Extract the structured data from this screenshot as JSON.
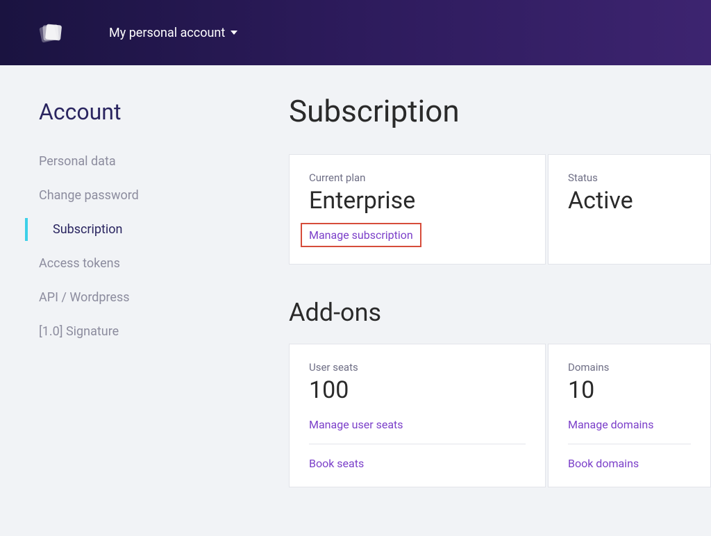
{
  "header": {
    "account_dropdown": "My personal account"
  },
  "sidebar": {
    "title": "Account",
    "items": [
      {
        "label": "Personal data"
      },
      {
        "label": "Change password"
      },
      {
        "label": "Subscription"
      },
      {
        "label": "Access tokens"
      },
      {
        "label": "API / Wordpress"
      },
      {
        "label": "[1.0] Signature"
      }
    ]
  },
  "main": {
    "title": "Subscription",
    "plan_card": {
      "label": "Current plan",
      "value": "Enterprise",
      "link": "Manage subscription"
    },
    "status_card": {
      "label": "Status",
      "value": "Active"
    },
    "addons_title": "Add-ons",
    "seats_card": {
      "label": "User seats",
      "value": "100",
      "link1": "Manage user seats",
      "link2": "Book seats"
    },
    "domains_card": {
      "label": "Domains",
      "value": "10",
      "link1": "Manage domains",
      "link2": "Book domains"
    }
  }
}
